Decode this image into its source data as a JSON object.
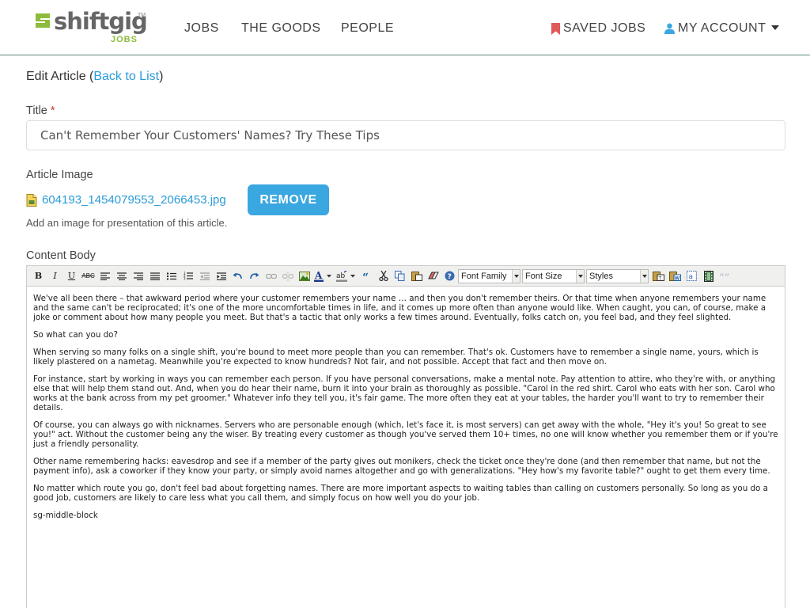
{
  "header": {
    "logo_text": "shiftgig",
    "logo_tm": "TM",
    "logo_sub": "JOBS",
    "nav": {
      "jobs": "JOBS",
      "goods": "THE GOODS",
      "people": "PEOPLE",
      "saved_jobs": "SAVED JOBS",
      "account": "MY ACCOUNT"
    },
    "colors": {
      "brand_green": "#8dbb3c",
      "bookmark_red": "#e05a5a",
      "user_blue": "#3aa7e0"
    }
  },
  "page": {
    "heading_prefix": "Edit Article (",
    "back_link": "Back to List",
    "heading_suffix": ")"
  },
  "form": {
    "title_label": "Title",
    "required_mark": "*",
    "title_value": "Can't Remember Your Customers' Names? Try These Tips",
    "image_label": "Article Image",
    "image_file": "604193_1454079553_2066453.jpg",
    "remove_label": "REMOVE",
    "image_help": "Add an image for presentation of this article.",
    "content_label": "Content Body"
  },
  "toolbar": {
    "bold": "B",
    "italic": "I",
    "underline": "U",
    "strike": "ABC",
    "font_family": "Font Family",
    "font_size": "Font Size",
    "styles": "Styles"
  },
  "content": {
    "p1": "We've all been there – that awkward period where your customer remembers your name … and then you don't remember theirs. Or that time when anyone remembers your name and the same can't be reciprocated; it's one of the more uncomfortable times in life, and it comes up more often than anyone would like. When caught, you can, of course, make a joke or comment about how many people you meet. But that's a tactic that only works a few times around. Eventually, folks catch on, you feel bad, and they feel slighted.",
    "p2": "So what can you do?",
    "p3": "When serving so many folks on a single shift, you're bound to meet more people than you can remember. That's ok. Customers have to remember a single name, yours, which is likely plastered on a nametag. Meanwhile you're expected to know hundreds? Not fair, and not possible. Accept that fact and then move on.",
    "p4": "For instance, start by working in ways you can remember each person. If you have personal conversations, make a mental note. Pay attention to attire, who they're with, or anything else that will help them stand out. And, when you do hear their name, burn it into your brain as thoroughly as possible. \"Carol in the red shirt. Carol who eats with her son. Carol who works at the bank across from my pet groomer.\" Whatever info they tell you, it's fair game. The more often they eat at your tables, the harder you'll want to try to remember their details.",
    "p5": "Of course, you can always go with nicknames. Servers who are personable enough (which, let's face it, is most servers) can get away with the whole, \"Hey it's you! So great to see you!\" act. Without the customer being any the wiser. By treating every customer as though you've served them 10+ times, no one will know whether you remember them or if you're just a friendly personality.",
    "p6": "Other name remembering hacks: eavesdrop and see if a member of the party gives out monikers, check the ticket once they're done (and then remember that name, but not the payment info), ask a coworker if they know your party, or simply avoid names altogether and go with generalizations. \"Hey how's my favorite table?\" ought to get them every time.",
    "p7": "No matter which route you go, don't feel bad about forgetting names. There are more important aspects to waiting tables than calling on customers personally. So long as you do a good job, customers are likely to care less what you call them, and simply focus on how well you do your job.",
    "p8": "sg-middle-block"
  }
}
